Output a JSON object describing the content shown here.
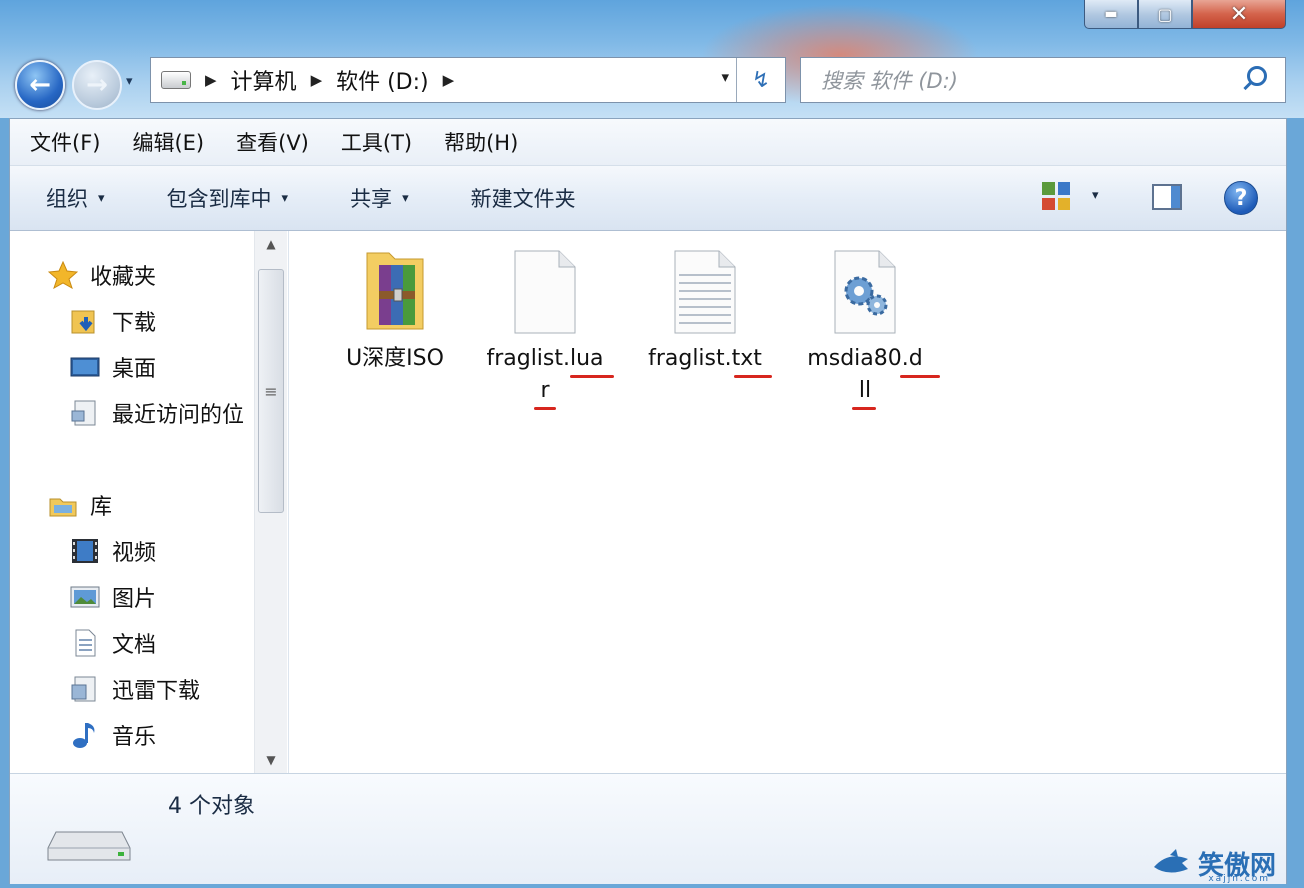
{
  "window": {
    "buttons": {
      "minimize": "▬",
      "maximize": "▢",
      "close": "✕"
    }
  },
  "nav": {
    "back": "←",
    "forward": "→",
    "history": "▾"
  },
  "address": {
    "crumbs": [
      "计算机",
      "软件 (D:)"
    ],
    "separator": "▶",
    "dropdown": "▾",
    "refresh": "↯"
  },
  "search": {
    "placeholder": "搜索 软件 (D:)"
  },
  "menubar": [
    "文件(F)",
    "编辑(E)",
    "查看(V)",
    "工具(T)",
    "帮助(H)"
  ],
  "commandbar": {
    "organize": "组织",
    "include_library": "包含到库中",
    "share": "共享",
    "new_folder": "新建文件夹",
    "dropdown": "▾",
    "help": "?"
  },
  "navpane": {
    "favorites": {
      "label": "收藏夹",
      "items": [
        "下载",
        "桌面",
        "最近访问的位"
      ]
    },
    "libraries": {
      "label": "库",
      "items": [
        "视频",
        "图片",
        "文档",
        "迅雷下载",
        "音乐"
      ]
    },
    "scroll": {
      "up": "▲",
      "down": "▼",
      "grip": "≡"
    }
  },
  "files": [
    {
      "name": "U深度ISO",
      "type": "folder"
    },
    {
      "name_line1": "fraglist.lua",
      "name_line2": "r",
      "type": "blank"
    },
    {
      "name": "fraglist.txt",
      "type": "text"
    },
    {
      "name_line1": "msdia80.d",
      "name_line2": "ll",
      "type": "dll"
    }
  ],
  "status": {
    "count": "4 个对象"
  },
  "watermark": {
    "text": "笑傲网",
    "url": "xajjn.com"
  },
  "colors": {
    "accent": "#2b6db5",
    "highlight_underline": "#d7261e",
    "close_red": "#c0402a"
  }
}
